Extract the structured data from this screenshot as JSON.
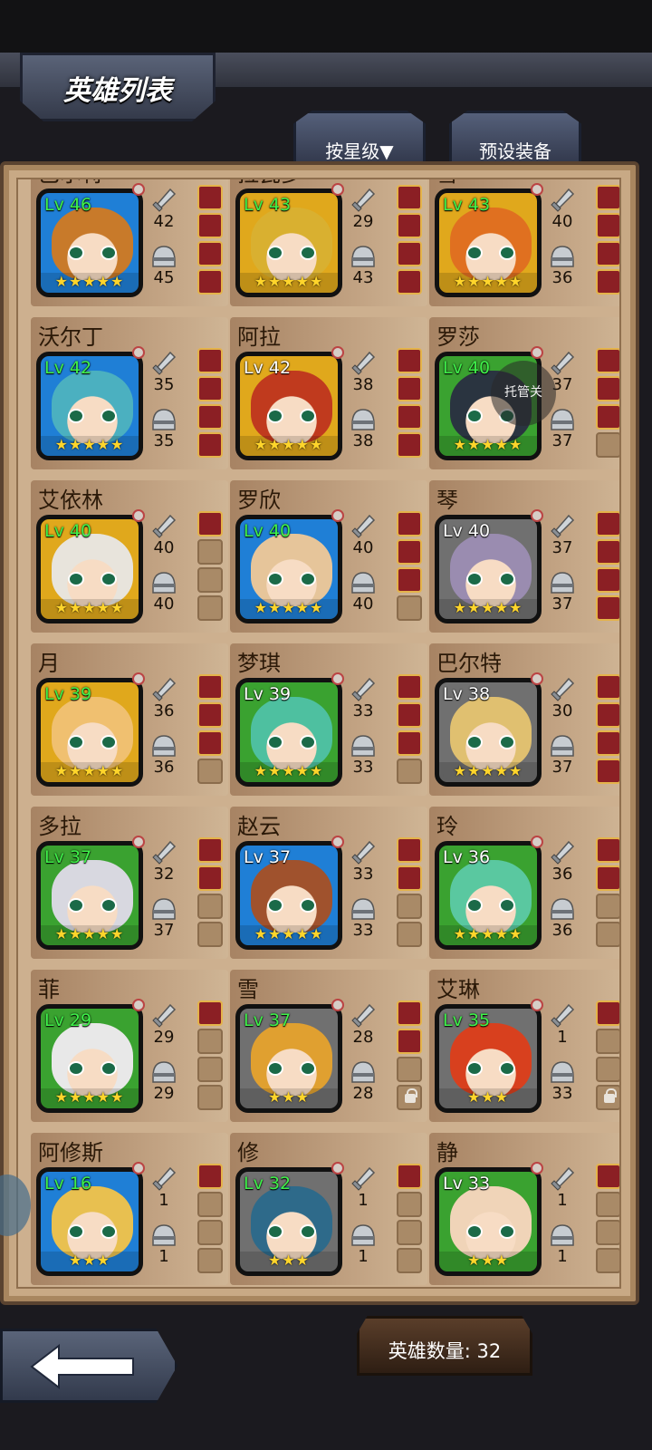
{
  "header": {
    "title": "英雄列表"
  },
  "tabs": {
    "sort_label": "按星级▼",
    "preset_label": "预设装备"
  },
  "float_button": {
    "label": "托管关"
  },
  "footer": {
    "hero_count_label": "英雄数量: 32"
  },
  "colors": {
    "level_green": "#3ff24a",
    "border_blue": "#1f7fd6",
    "border_gold": "#e0a81c",
    "border_green": "#3aa230",
    "border_gray": "#707070"
  },
  "heroes": [
    {
      "name": "巴尔特",
      "level": "Lv 46",
      "atk": "42",
      "def": "45",
      "stars": 5,
      "border": "blue",
      "hair": "#c87a2a",
      "level_color": "green",
      "slots": [
        "filled",
        "filled",
        "filled",
        "filled"
      ]
    },
    {
      "name": "拉瓦多",
      "level": "Lv 43",
      "atk": "29",
      "def": "43",
      "stars": 5,
      "border": "gold",
      "hair": "#d9b030",
      "level_color": "green",
      "slots": [
        "filled",
        "filled",
        "filled",
        "filled"
      ]
    },
    {
      "name": "雪",
      "level": "Lv 43",
      "atk": "40",
      "def": "36",
      "stars": 5,
      "border": "gold",
      "hair": "#e07020",
      "level_color": "green",
      "slots": [
        "filled",
        "filled",
        "filled",
        "filled"
      ]
    },
    {
      "name": "沃尔丁",
      "level": "Lv 42",
      "atk": "35",
      "def": "35",
      "stars": 5,
      "border": "blue",
      "hair": "#4bb0c0",
      "level_color": "green",
      "slots": [
        "filled",
        "filled",
        "filled",
        "filled"
      ]
    },
    {
      "name": "阿拉",
      "level": "Lv 42",
      "atk": "38",
      "def": "38",
      "stars": 5,
      "border": "gold",
      "hair": "#c03a1e",
      "level_color": "white",
      "slots": [
        "filled",
        "filled",
        "filled",
        "filled"
      ]
    },
    {
      "name": "罗莎",
      "level": "Lv 40",
      "atk": "37",
      "def": "37",
      "stars": 5,
      "border": "green",
      "hair": "#2a3440",
      "level_color": "green",
      "slots": [
        "filled",
        "filled",
        "filled",
        "empty"
      ]
    },
    {
      "name": "艾依林",
      "level": "Lv 40",
      "atk": "40",
      "def": "40",
      "stars": 5,
      "border": "gold",
      "hair": "#e8e4dc",
      "level_color": "green",
      "slots": [
        "filled",
        "empty",
        "empty",
        "empty"
      ]
    },
    {
      "name": "罗欣",
      "level": "Lv 40",
      "atk": "40",
      "def": "40",
      "stars": 5,
      "border": "blue",
      "hair": "#e6c59a",
      "level_color": "green",
      "slots": [
        "filled",
        "filled",
        "filled",
        "empty"
      ]
    },
    {
      "name": "琴",
      "level": "Lv 40",
      "atk": "37",
      "def": "37",
      "stars": 5,
      "border": "gray",
      "hair": "#9a8cb0",
      "level_color": "white",
      "slots": [
        "filled",
        "filled",
        "filled",
        "filled"
      ]
    },
    {
      "name": "月",
      "level": "Lv 39",
      "atk": "36",
      "def": "36",
      "stars": 5,
      "border": "gold",
      "hair": "#f0c070",
      "level_color": "green",
      "slots": [
        "filled",
        "filled",
        "filled",
        "empty"
      ]
    },
    {
      "name": "梦琪",
      "level": "Lv 39",
      "atk": "33",
      "def": "33",
      "stars": 5,
      "border": "green",
      "hair": "#4ec0a0",
      "level_color": "white",
      "slots": [
        "filled",
        "filled",
        "filled",
        "empty"
      ]
    },
    {
      "name": "巴尔特",
      "level": "Lv 38",
      "atk": "30",
      "def": "37",
      "stars": 5,
      "border": "gray",
      "hair": "#e0c070",
      "level_color": "white",
      "slots": [
        "filled",
        "filled",
        "filled",
        "filled"
      ]
    },
    {
      "name": "多拉",
      "level": "Lv 37",
      "atk": "32",
      "def": "37",
      "stars": 5,
      "border": "green",
      "hair": "#d8d8e0",
      "level_color": "green",
      "slots": [
        "filled",
        "filled",
        "empty",
        "empty"
      ]
    },
    {
      "name": "赵云",
      "level": "Lv 37",
      "atk": "33",
      "def": "33",
      "stars": 5,
      "border": "blue",
      "hair": "#a0522d",
      "level_color": "white",
      "slots": [
        "filled",
        "filled",
        "empty",
        "empty"
      ]
    },
    {
      "name": "玲",
      "level": "Lv 36",
      "atk": "36",
      "def": "36",
      "stars": 5,
      "border": "green",
      "hair": "#5ac8a0",
      "level_color": "white",
      "slots": [
        "filled",
        "filled",
        "empty",
        "empty"
      ]
    },
    {
      "name": "菲",
      "level": "Lv 29",
      "atk": "29",
      "def": "29",
      "stars": 5,
      "border": "green",
      "hair": "#e8e8e8",
      "level_color": "green",
      "slots": [
        "filled",
        "empty",
        "empty",
        "empty"
      ]
    },
    {
      "name": "雪",
      "level": "Lv 37",
      "atk": "28",
      "def": "28",
      "stars": 3,
      "border": "gray",
      "hair": "#e0a030",
      "level_color": "green",
      "slots": [
        "filled",
        "filled",
        "empty",
        "lock"
      ]
    },
    {
      "name": "艾琳",
      "level": "Lv 35",
      "atk": "1",
      "def": "33",
      "stars": 3,
      "border": "gray",
      "hair": "#d8401e",
      "level_color": "green",
      "slots": [
        "filled",
        "empty",
        "empty",
        "lock"
      ]
    },
    {
      "name": "阿修斯",
      "level": "Lv 16",
      "atk": "1",
      "def": "1",
      "stars": 3,
      "border": "blue",
      "hair": "#e8c050",
      "level_color": "green",
      "slots": [
        "filled",
        "empty",
        "empty",
        "empty"
      ]
    },
    {
      "name": "修",
      "level": "Lv 32",
      "atk": "1",
      "def": "1",
      "stars": 3,
      "border": "gray",
      "hair": "#2e6a8a",
      "level_color": "green",
      "slots": [
        "filled",
        "empty",
        "empty",
        "empty"
      ]
    },
    {
      "name": "静",
      "level": "Lv 33",
      "atk": "1",
      "def": "1",
      "stars": 3,
      "border": "green",
      "hair": "#f0d4b8",
      "level_color": "white",
      "slots": [
        "filled",
        "empty",
        "empty",
        "empty"
      ]
    }
  ]
}
